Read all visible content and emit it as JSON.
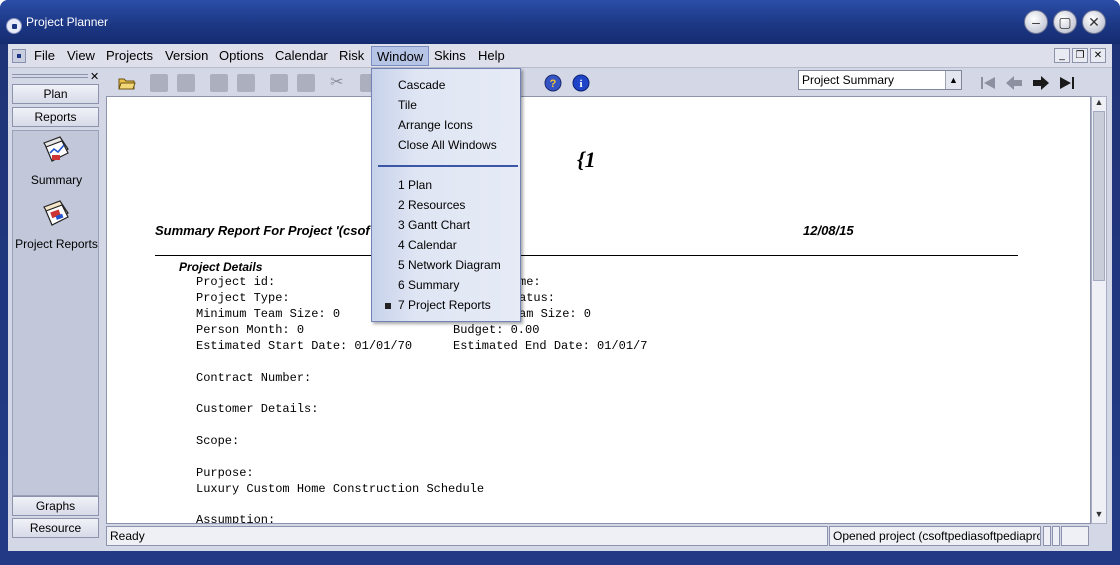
{
  "window": {
    "title": "Project Planner"
  },
  "menubar": {
    "items": [
      "File",
      "View",
      "Projects",
      "Version",
      "Options",
      "Calendar",
      "Risk",
      "Window",
      "Skins",
      "Help"
    ],
    "active": "Window"
  },
  "left_panel": {
    "buttons": {
      "plan": "Plan",
      "reports": "Reports",
      "graphs": "Graphs",
      "resource": "Resource"
    },
    "items": [
      {
        "label": "Summary",
        "icon": "summary-report-icon"
      },
      {
        "label": "Project Reports",
        "icon": "project-reports-icon"
      }
    ]
  },
  "toolbar": {
    "project_select": "Project Summary",
    "nav_icons": [
      "first-icon",
      "previous-icon",
      "next-icon",
      "last-icon"
    ]
  },
  "window_menu": {
    "items": [
      "Cascade",
      "Tile",
      "Arrange Icons",
      "Close All Windows"
    ],
    "windows": [
      "1 Plan",
      "2 Resources",
      "3 Gantt Chart",
      "4 Calendar",
      "5 Network Diagram",
      "6 Summary",
      "7 Project Reports"
    ],
    "checked": "7 Project Reports"
  },
  "report": {
    "logo_text": "{1",
    "title": "Summary Report For Project '(csof",
    "date": "12/08/15",
    "section": "Project Details",
    "lines": [
      "Project id:",
      "Project Type:",
      "Minimum Team Size: 0",
      "Person Month: 0",
      "Estimated Start Date: 01/01/70",
      "Contract Number:",
      "Customer Details:",
      "Scope:",
      "Purpose:",
      "Luxury Custom Home Construction Schedule",
      "Assumption:"
    ],
    "right_lines": [
      "me:",
      "atus:",
      "am Size: 0",
      "Budget: 0.00",
      "Estimated End Date: 01/01/7"
    ]
  },
  "statusbar": {
    "left": "Ready",
    "right": "Opened project (csoftpediasoftpediaproject."
  },
  "colors": {
    "titlebar": "#1b3682",
    "menu_highlight": "#b6c4e6",
    "separator": "#3c56a6"
  }
}
